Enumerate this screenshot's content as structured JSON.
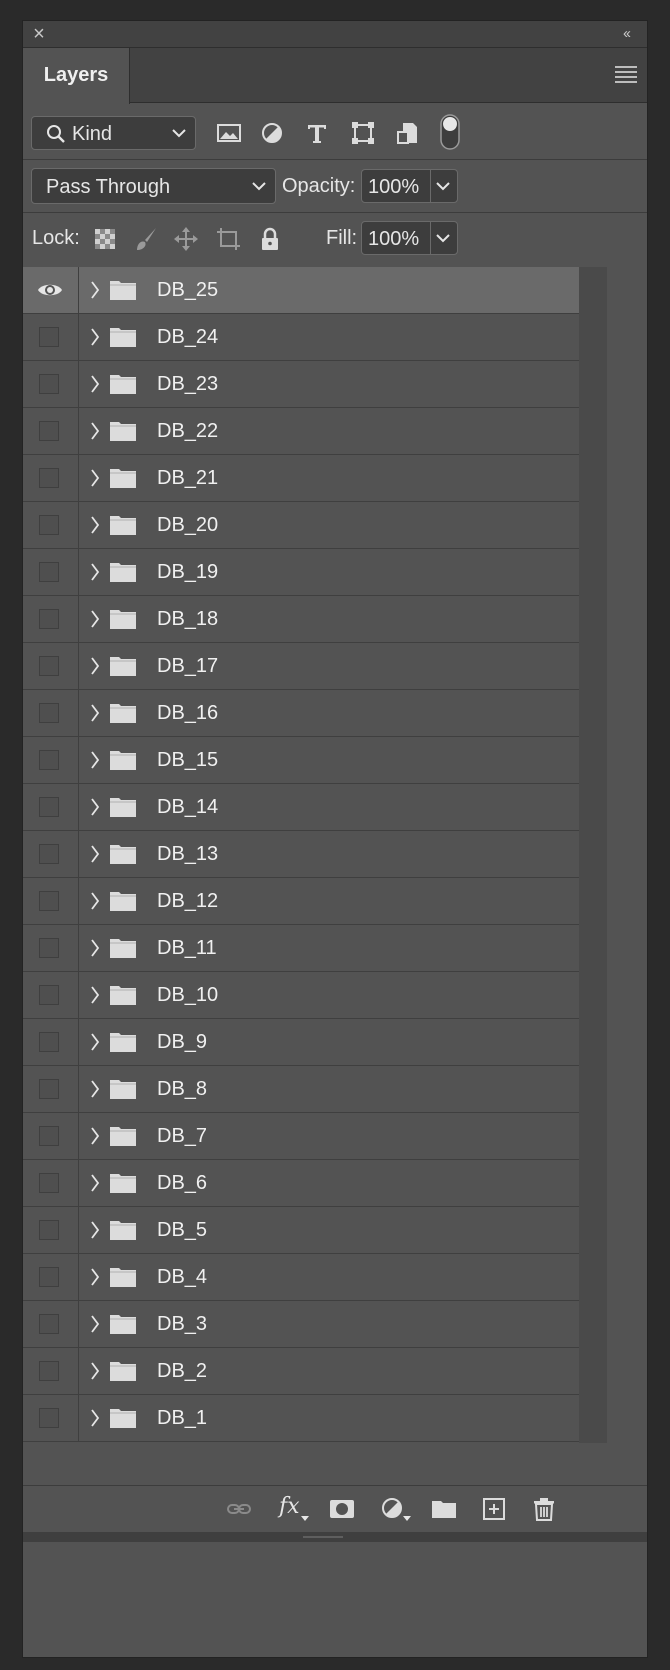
{
  "panel": {
    "close_glyph": "×",
    "collapse_glyph": "‹‹",
    "tab_label": "Layers"
  },
  "filter": {
    "kind_label": "Kind",
    "icons": [
      "image-filter-icon",
      "adjustment-filter-icon",
      "type-filter-icon",
      "shape-filter-icon",
      "smart-object-filter-icon",
      "filter-toggle-icon"
    ]
  },
  "blend": {
    "mode": "Pass Through",
    "opacity_label": "Opacity:",
    "opacity_value": "100%"
  },
  "lock": {
    "label": "Lock:",
    "icons": [
      "lock-transparent-pixels-icon",
      "lock-image-pixels-icon",
      "lock-position-icon",
      "lock-artboard-icon",
      "lock-all-icon"
    ],
    "fill_label": "Fill:",
    "fill_value": "100%"
  },
  "layers": [
    {
      "name": "DB_25",
      "visible": true,
      "selected": true
    },
    {
      "name": "DB_24",
      "visible": false
    },
    {
      "name": "DB_23",
      "visible": false
    },
    {
      "name": "DB_22",
      "visible": false
    },
    {
      "name": "DB_21",
      "visible": false
    },
    {
      "name": "DB_20",
      "visible": false
    },
    {
      "name": "DB_19",
      "visible": false
    },
    {
      "name": "DB_18",
      "visible": false
    },
    {
      "name": "DB_17",
      "visible": false
    },
    {
      "name": "DB_16",
      "visible": false
    },
    {
      "name": "DB_15",
      "visible": false
    },
    {
      "name": "DB_14",
      "visible": false
    },
    {
      "name": "DB_13",
      "visible": false
    },
    {
      "name": "DB_12",
      "visible": false
    },
    {
      "name": "DB_11",
      "visible": false
    },
    {
      "name": "DB_10",
      "visible": false
    },
    {
      "name": "DB_9",
      "visible": false
    },
    {
      "name": "DB_8",
      "visible": false
    },
    {
      "name": "DB_7",
      "visible": false
    },
    {
      "name": "DB_6",
      "visible": false
    },
    {
      "name": "DB_5",
      "visible": false
    },
    {
      "name": "DB_4",
      "visible": false
    },
    {
      "name": "DB_3",
      "visible": false
    },
    {
      "name": "DB_2",
      "visible": false
    },
    {
      "name": "DB_1",
      "visible": false
    }
  ],
  "bottom_toolbar": {
    "fx_label": "fx",
    "icons": [
      "link-layers-icon",
      "layer-style-icon",
      "add-mask-icon",
      "adjustment-layer-icon",
      "new-group-icon",
      "new-layer-icon",
      "delete-layer-icon"
    ]
  },
  "colors": {
    "panel_bg": "#535353",
    "header_bg": "#424242",
    "selected_row": "#6a6a6a",
    "text": "#e6e6e6"
  }
}
